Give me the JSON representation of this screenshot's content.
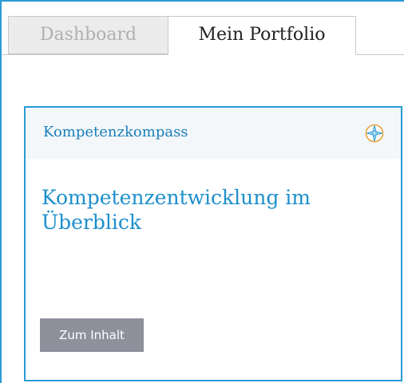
{
  "tabs": [
    {
      "label": "Dashboard",
      "active": false
    },
    {
      "label": "Mein Portfolio",
      "active": true
    }
  ],
  "card": {
    "header_title": "Kompetenzkompass",
    "header_icon": "compass-icon",
    "title": "Kompetenzentwicklung im Überblick",
    "button_label": "Zum Inhalt"
  },
  "colors": {
    "accent_blue": "#2a9bd6",
    "title_blue": "#1c8fcc",
    "icon_orange": "#e9a03b",
    "button_gray": "#8e909c",
    "header_bg": "#f3f7fa"
  }
}
